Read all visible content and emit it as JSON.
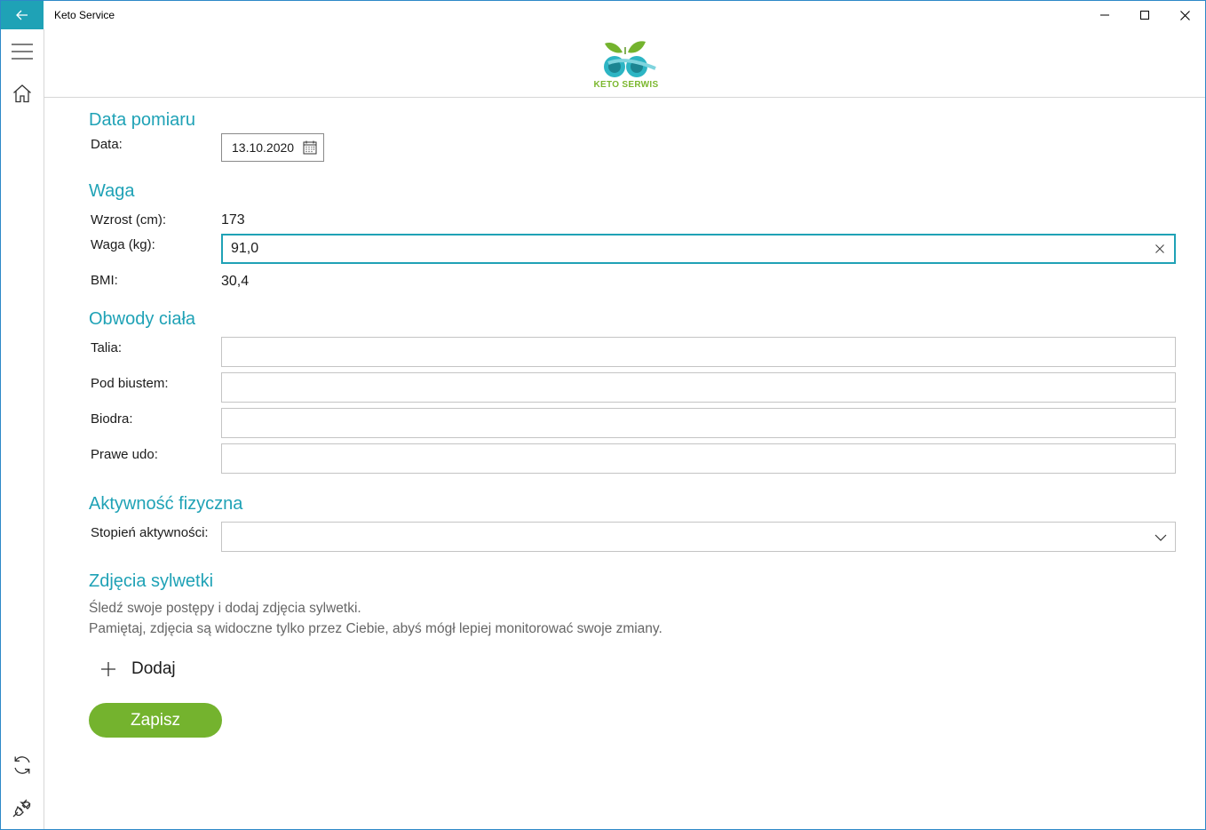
{
  "window": {
    "title": "Keto Service",
    "icons": {
      "back": "back-arrow-icon",
      "minimize": "minimize-icon",
      "maximize": "maximize-icon",
      "close": "close-icon"
    }
  },
  "nav": {
    "icons": [
      "hamburger-menu-icon",
      "home-icon",
      "sync-icon",
      "plug-icon"
    ]
  },
  "header": {
    "logo_text": "KETO SERWIS"
  },
  "form": {
    "date_section": {
      "title": "Data pomiaru",
      "date_label": "Data:",
      "date_value": "13.10.2020"
    },
    "weight_section": {
      "title": "Waga",
      "height_label": "Wzrost (cm):",
      "height_value": "173",
      "weight_label": "Waga (kg):",
      "weight_value": "91,0",
      "bmi_label": "BMI:",
      "bmi_value": "30,4"
    },
    "body_section": {
      "title": "Obwody ciała",
      "fields": [
        {
          "label": "Talia:",
          "value": ""
        },
        {
          "label": "Pod biustem:",
          "value": ""
        },
        {
          "label": "Biodra:",
          "value": ""
        },
        {
          "label": "Prawe udo:",
          "value": ""
        }
      ]
    },
    "activity_section": {
      "title": "Aktywność fizyczna",
      "level_label": "Stopień aktywności:",
      "level_value": ""
    },
    "photos_section": {
      "title": "Zdjęcia sylwetki",
      "description_line1": "Śledź swoje postępy i dodaj zdjęcia sylwetki.",
      "description_line2": "Pamiętaj, zdjęcia są widoczne tylko przez Ciebie, abyś mógł lepiej monitorować swoje zmiany.",
      "add_label": "Dodaj"
    },
    "save_label": "Zapisz"
  },
  "colors": {
    "accent": "#1fa2b6",
    "save": "#74b32e"
  }
}
